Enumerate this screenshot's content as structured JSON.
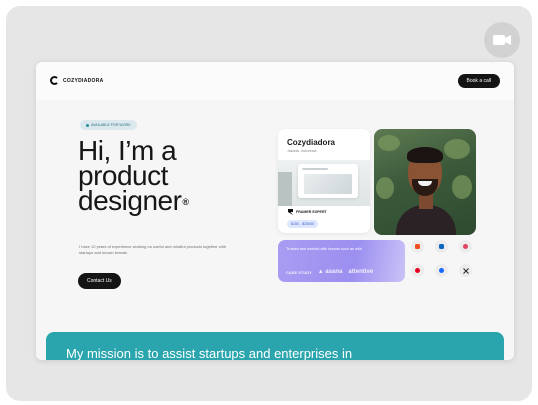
{
  "colors": {
    "frame_bg": "#e6e6e6",
    "dark_button": "#141414",
    "brand_card": "#a99cf2",
    "mission_teal": "#2aa5ae",
    "badge_bg": "#dbe9ef"
  },
  "overlay": {
    "video_icon": "video-camera-icon"
  },
  "nav": {
    "logo_text": "COZYDIADORA",
    "book_label": "Book a call"
  },
  "hero": {
    "badge": "AVAILABLE FOR WORK",
    "headline_line1": "Hi, I’m a",
    "headline_line2": "product",
    "headline_line3": "designer",
    "registered_mark": "®",
    "intro": "I have 10 years of experience working on useful and mindful products together with startups and known brands",
    "contact_label": "Contact Us"
  },
  "site_card": {
    "name": "Cozydiadora",
    "subtitle": "Jakarta, Indonesia",
    "expert_label": "FRAMER EXPERT",
    "pill": "$150 - $25000"
  },
  "brand_card": {
    "text": "Trusted and worked with brands such as with",
    "logos": [
      "CASE STUDY",
      "▲ asana",
      "attentive"
    ]
  },
  "social_icons": [
    {
      "name": "figma-icon",
      "color": "#f24e1e"
    },
    {
      "name": "linkedin-icon",
      "color": "#0a66c2"
    },
    {
      "name": "dribbble-icon",
      "color": "#e4405f"
    },
    {
      "name": "pinterest-icon",
      "color": "#e60023"
    },
    {
      "name": "behance-icon",
      "color": "#1769ff"
    },
    {
      "name": "x-icon",
      "color": "#222222"
    }
  ],
  "mission": {
    "text": "My mission is to assist startups and enterprises in"
  }
}
